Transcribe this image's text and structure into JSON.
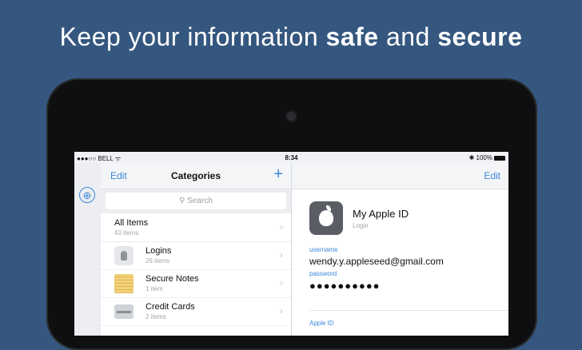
{
  "headline": {
    "regular": "Keep your information ",
    "bold1": "safe",
    "middle": " and ",
    "bold2": "secure"
  },
  "status_bar": {
    "carrier": "●●●○○ BELL ",
    "wifi": "ᯤ",
    "time": "8:34",
    "bluetooth": "✱",
    "battery": "100%"
  },
  "sidebar": {
    "icon": "compass-icon"
  },
  "list": {
    "edit_label": "Edit",
    "title": "Categories",
    "add_label": "+",
    "search_placeholder": "Search",
    "search_icon": "search-icon",
    "items": [
      {
        "title": "All Items",
        "count": "43 items"
      },
      {
        "title": "Logins",
        "count": "26 items",
        "icon": "login-icon"
      },
      {
        "title": "Secure Notes",
        "count": "1 item",
        "icon": "notes-icon"
      },
      {
        "title": "Credit Cards",
        "count": "2 items",
        "icon": "credit-card-icon"
      }
    ]
  },
  "detail": {
    "edit_label": "Edit",
    "item_title": "My Apple ID",
    "item_type": "Login",
    "fields": [
      {
        "label": "username",
        "value": "wendy.y.appleseed@gmail.com"
      },
      {
        "label": "password",
        "value": "●●●●●●●●●●"
      }
    ],
    "next_section_label": "Apple ID"
  },
  "colors": {
    "background": "#35577f",
    "accent": "#3a87d9"
  }
}
